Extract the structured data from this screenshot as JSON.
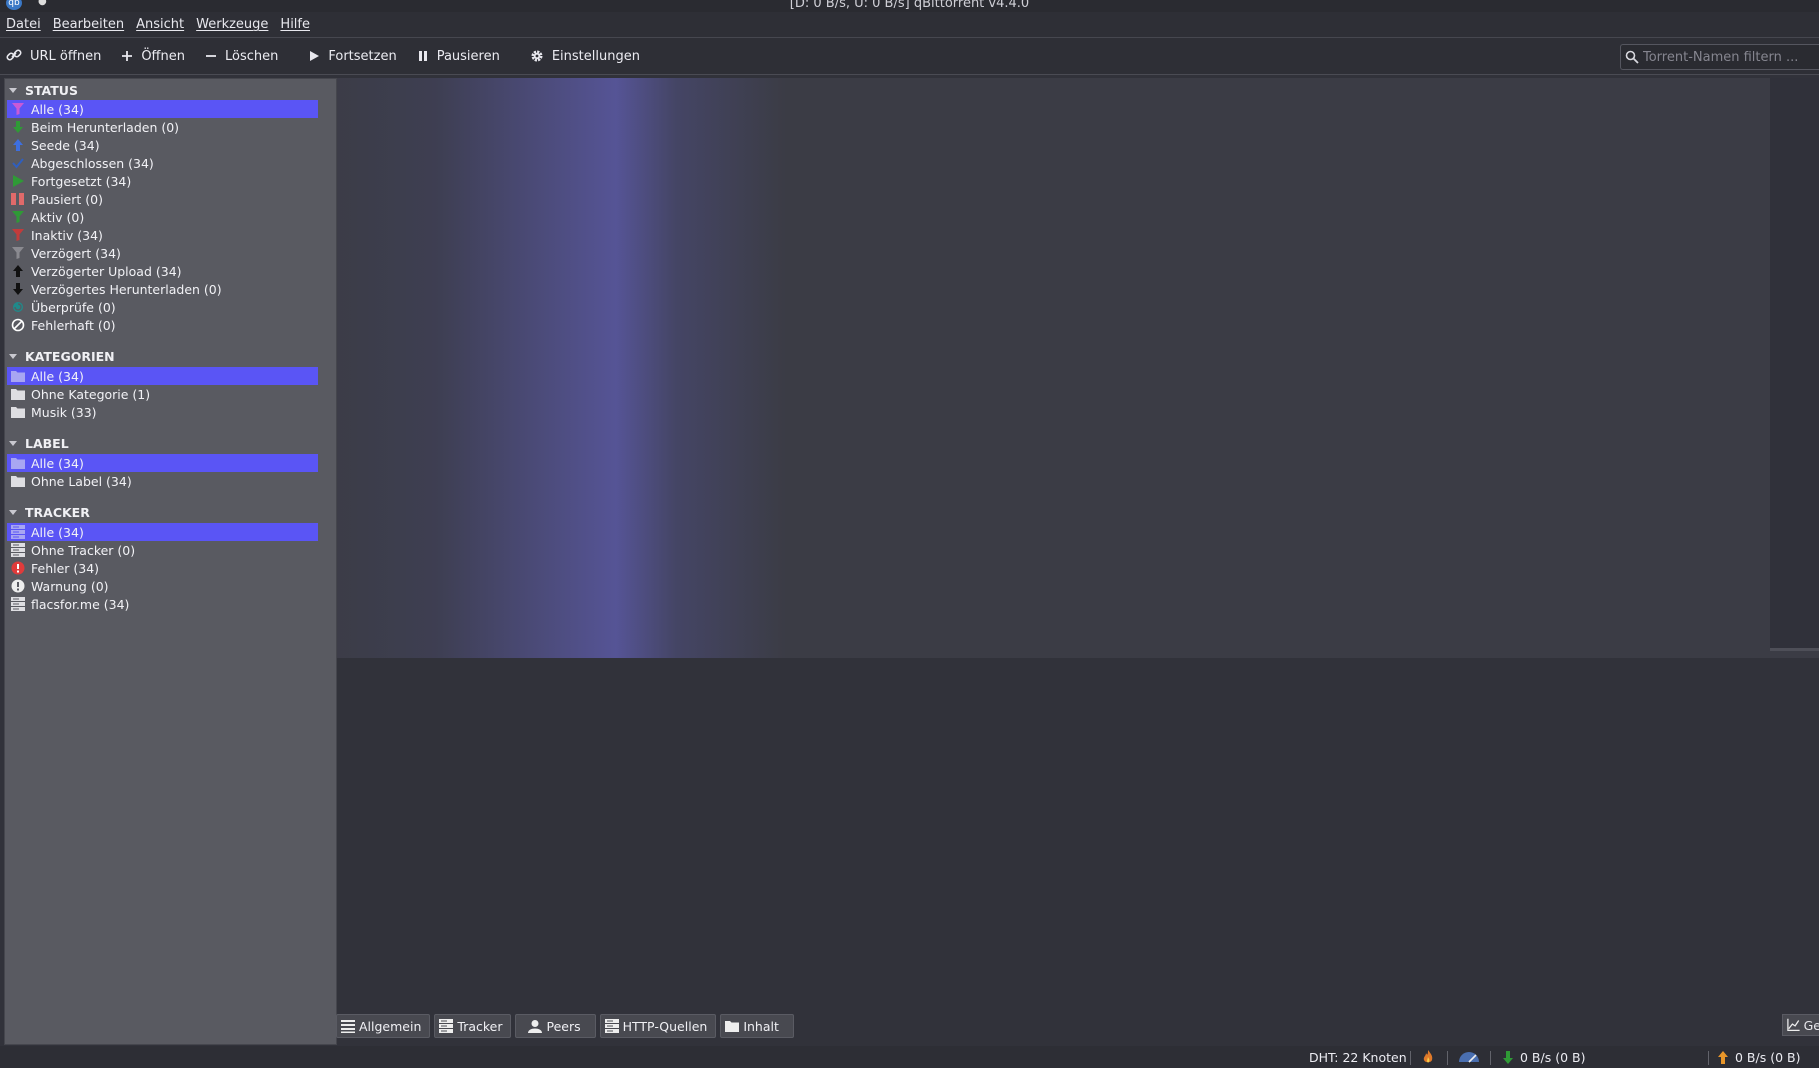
{
  "window": {
    "title": "[D: 0 B/s, U: 0 B/s] qBittorrent v4.4.0",
    "app_icon_text": "qb"
  },
  "menubar": [
    "Datei",
    "Bearbeiten",
    "Ansicht",
    "Werkzeuge",
    "Hilfe"
  ],
  "toolbar": {
    "open_url": "URL öffnen",
    "open": "Öffnen",
    "delete": "Löschen",
    "resume": "Fortsetzen",
    "pause": "Pausieren",
    "settings": "Einstellungen"
  },
  "search": {
    "placeholder": "Torrent-Namen filtern ..."
  },
  "sidebar": {
    "status": {
      "header": "STATUS",
      "items": [
        {
          "label": "Alle (34)",
          "icon": "filter-icon",
          "color": "#c85ad6"
        },
        {
          "label": "Beim Herunterladen (0)",
          "icon": "download-icon",
          "color": "#2f9a36"
        },
        {
          "label": "Seede (34)",
          "icon": "upload-icon",
          "color": "#3d6fe0"
        },
        {
          "label": "Abgeschlossen (34)",
          "icon": "check-icon",
          "color": "#2f5fbf"
        },
        {
          "label": "Fortgesetzt (34)",
          "icon": "play-icon",
          "color": "#2f9a36"
        },
        {
          "label": "Pausiert (0)",
          "icon": "pause-icon",
          "color": "#e06a6a"
        },
        {
          "label": "Aktiv (0)",
          "icon": "filter-icon",
          "color": "#2f9a36"
        },
        {
          "label": "Inaktiv (34)",
          "icon": "filter-icon",
          "color": "#c23b3b"
        },
        {
          "label": "Verzögert (34)",
          "icon": "filter-icon",
          "color": "#8a8a90"
        },
        {
          "label": "Verzögerter Upload (34)",
          "icon": "arrow-up-icon",
          "color": "#111111"
        },
        {
          "label": "Verzögertes Herunterladen (0)",
          "icon": "arrow-down-icon",
          "color": "#111111"
        },
        {
          "label": "Überprüfe (0)",
          "icon": "refresh-icon",
          "color": "#1f8a8a"
        },
        {
          "label": "Fehlerhaft (0)",
          "icon": "error-icon",
          "color": "#ffffff"
        }
      ]
    },
    "categories": {
      "header": "KATEGORIEN",
      "items": [
        "Alle (34)",
        "Ohne Kategorie (1)",
        "Musik (33)"
      ]
    },
    "labels": {
      "header": "LABEL",
      "items": [
        "Alle (34)",
        "Ohne Label (34)"
      ]
    },
    "trackers": {
      "header": "TRACKER",
      "items": [
        {
          "label": "Alle (34)",
          "icon": "server-icon"
        },
        {
          "label": "Ohne Tracker (0)",
          "icon": "server-icon"
        },
        {
          "label": "Fehler (34)",
          "icon": "error-circle-icon",
          "color": "#e03b3b"
        },
        {
          "label": "Warnung (0)",
          "icon": "warning-icon",
          "color": "#eeeeee"
        },
        {
          "label": "flacsfor.me (34)",
          "icon": "server-icon"
        }
      ]
    }
  },
  "detail_tabs": [
    "Allgemein",
    "Tracker",
    "Peers",
    "HTTP-Quellen",
    "Inhalt"
  ],
  "graph_tab": "Ge",
  "statusbar": {
    "dht": "DHT: 22 Knoten",
    "download": "0 B/s (0 B)",
    "upload": "0 B/s (0 B)"
  },
  "colors": {
    "selection": "#5a55f5",
    "sidebar_bg": "#595a61",
    "window_bg": "#31323a"
  }
}
